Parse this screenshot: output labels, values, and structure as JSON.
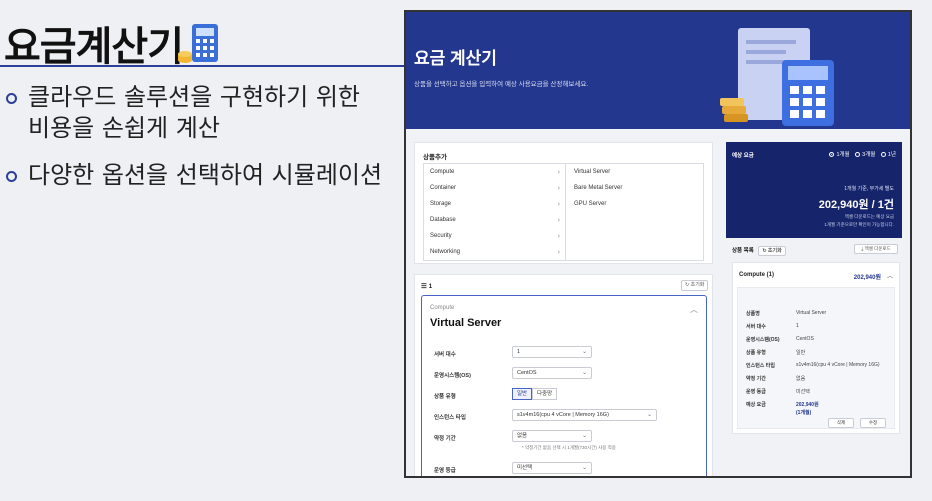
{
  "slide": {
    "title": "요금계산기",
    "bullets": [
      {
        "line1": "클라우드 솔루션을 구현하기 위한",
        "line2": "비용을 손쉽게 계산"
      },
      {
        "line1": "다양한 옵션을 선택하여 시뮬레이션",
        "line2": ""
      }
    ]
  },
  "app": {
    "hero": {
      "title": "요금 계산기",
      "subtitle": "상품을 선택하고 옵션을 입력하여 예상 사용요금을 산정해보세요."
    },
    "product_add": {
      "label": "상품추가",
      "categories": [
        "Compute",
        "Container",
        "Storage",
        "Database",
        "Security",
        "Networking"
      ],
      "subitems": [
        "Virtual Server",
        "Bare Metal Server",
        "GPU Server"
      ]
    },
    "server": {
      "section_label": "1",
      "reset_label": "초기화",
      "category": "Compute",
      "name": "Virtual Server",
      "fields": {
        "count_label": "서버 대수",
        "count_value": "1",
        "os_label": "운영시스템(OS)",
        "os_value": "CentOS",
        "type_label": "상품 유형",
        "type_opt1": "일반",
        "type_opt2": "다중망",
        "instance_label": "인스턴스 타입",
        "instance_value": "s1v4m16(cpu 4 vCore | Memory 16G)",
        "term_label": "약정 기간",
        "term_value": "없음",
        "term_note": "* 약정기간 없음 선택 시 1개월(730시간) 사용 적용",
        "grade_label": "운영 등급",
        "grade_value": "미선택"
      }
    },
    "estimate": {
      "label": "예상 요금",
      "periods": [
        "1개월",
        "3개월",
        "1년"
      ],
      "selected_period": "1개월",
      "basis": "1개월 기준, 부가세 별도",
      "price": "202,940원 / 1건",
      "note1": "엑셀 다운로드는 예상 요금",
      "note2": "1개월 기준으로만 확인이 가능합니다."
    },
    "summary": {
      "list_label": "상품 목록",
      "reset_label": "초기화",
      "download_label": "엑셀 다운로드",
      "head": "Compute (1)",
      "total": "202,940원",
      "rows": [
        {
          "k": "상품명",
          "v": "Virtual Server"
        },
        {
          "k": "서버 대수",
          "v": "1"
        },
        {
          "k": "운영시스템(OS)",
          "v": "CentOS"
        },
        {
          "k": "상품 유형",
          "v": "일반"
        },
        {
          "k": "인스턴스 타입",
          "v": "s1v4m16(cpu 4 vCore | Memory 16G)"
        },
        {
          "k": "약정 기간",
          "v": "없음"
        },
        {
          "k": "운영 등급",
          "v": "미선택"
        }
      ],
      "fee_label": "예상 요금",
      "fee_value": "202,940원",
      "fee_sub": "(1개월)",
      "delete_label": "삭제",
      "edit_label": "수정"
    }
  }
}
